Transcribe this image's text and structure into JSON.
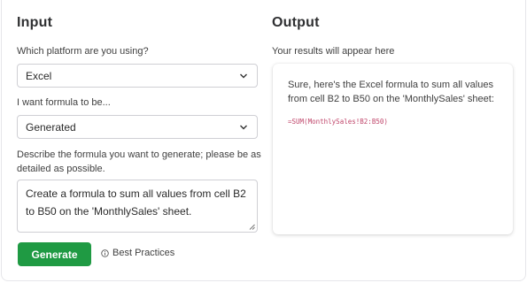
{
  "input": {
    "heading": "Input",
    "platform_label": "Which platform are you using?",
    "platform_value": "Excel",
    "formula_label": "I want formula to be...",
    "formula_value": "Generated",
    "describe_label_line1": "Describe the formula you want to generate; please be as",
    "describe_label_line2": "detailed as possible.",
    "describe_value": "Create a formula to sum all values from cell B2 to B50 on the 'MonthlySales' sheet.",
    "generate_label": "Generate",
    "best_practices_label": "Best Practices"
  },
  "output": {
    "heading": "Output",
    "subheading": "Your results will appear here",
    "result_text": "Sure, here's the Excel formula to sum all values from cell B2 to B50 on the 'MonthlySales' sheet:",
    "result_code": "=SUM(MonthlySales!B2:B50)"
  },
  "icons": {
    "select_chevron": "chevron-down-icon",
    "best_practices": "info-icon",
    "resize": "resize-grip-icon"
  },
  "colors": {
    "accent_green": "#1f9a43",
    "code_pink": "#c0466b"
  }
}
